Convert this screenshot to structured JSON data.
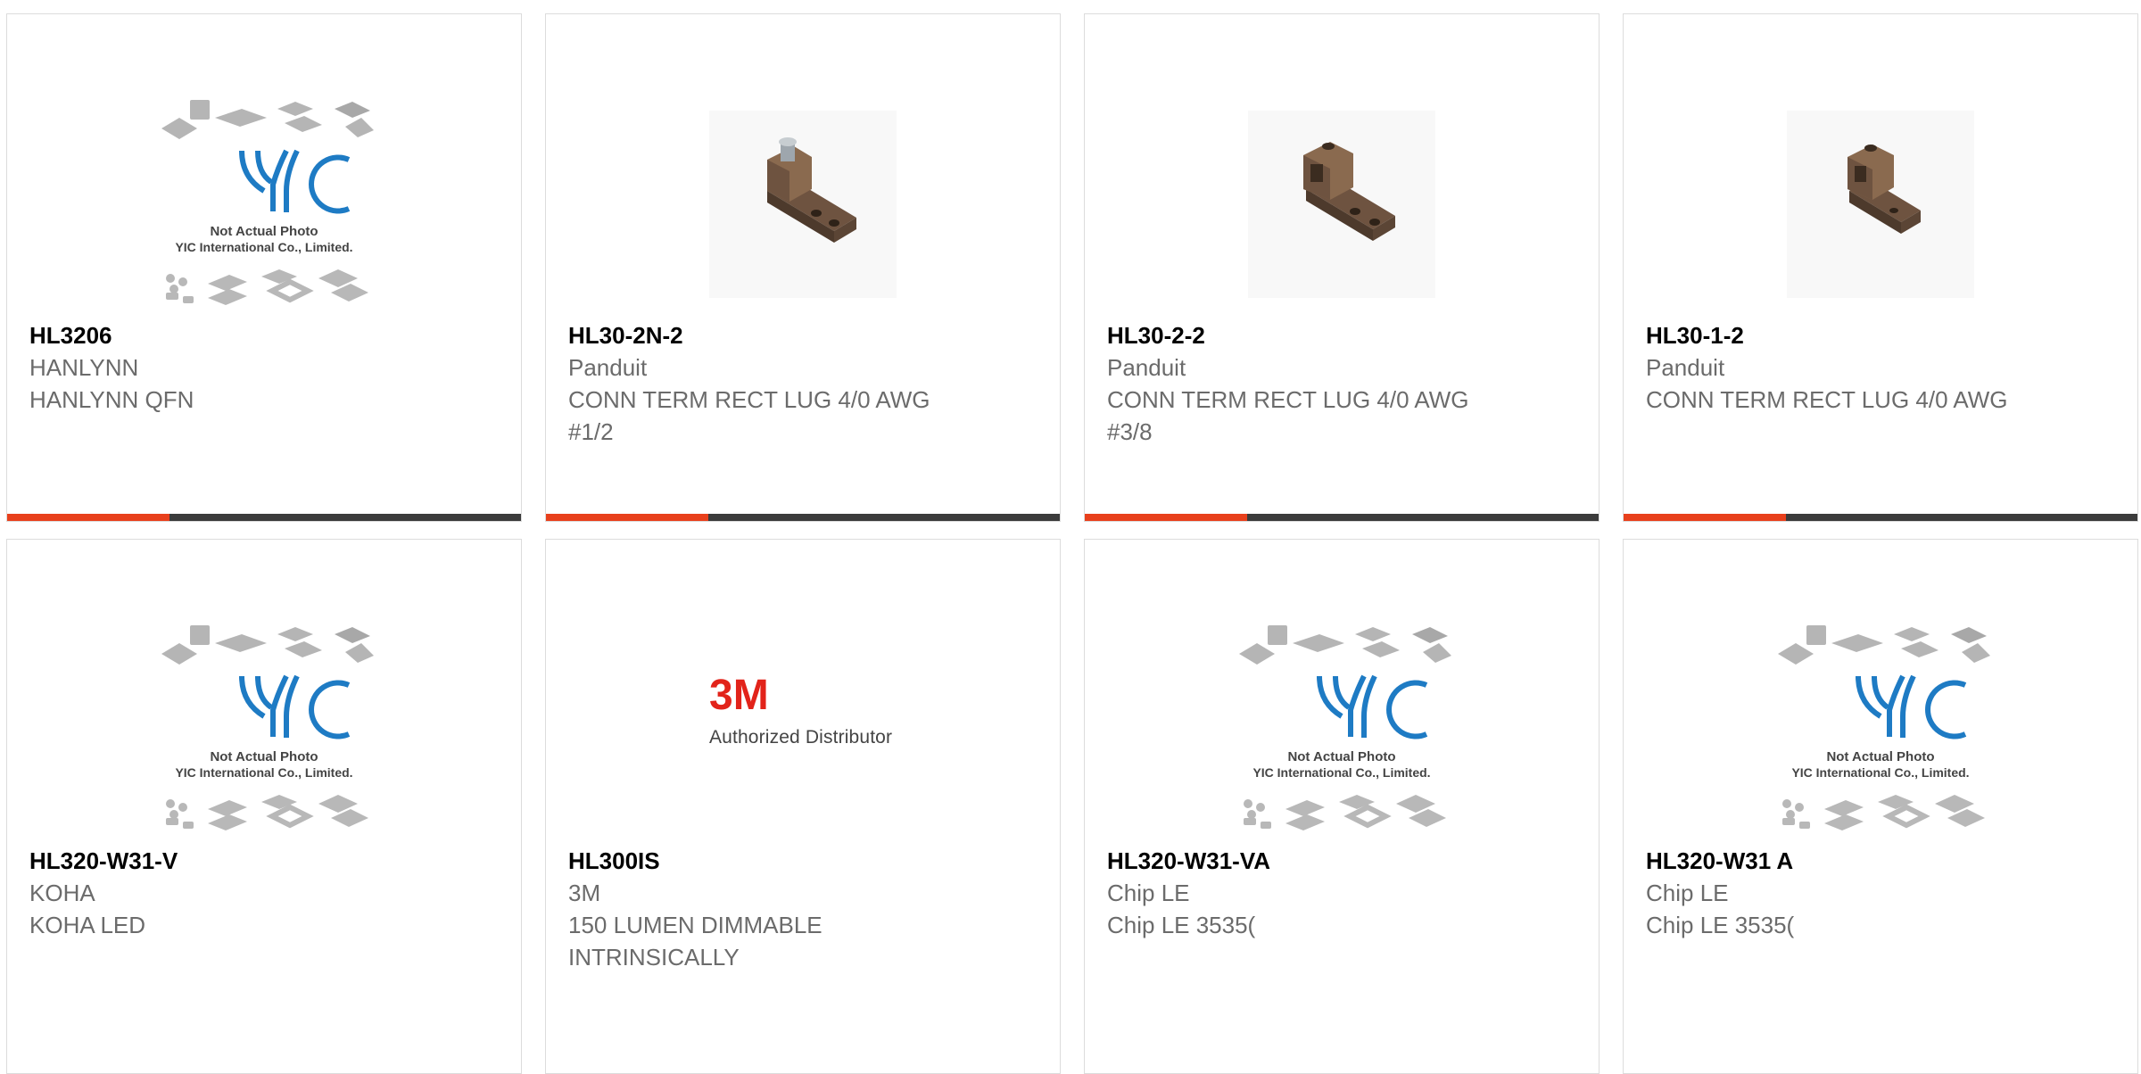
{
  "products": [
    {
      "part": "HL3206",
      "brand": "HANLYNN",
      "description": "HANLYNN QFN",
      "image": "placeholder",
      "placeholder_lines": [
        "Not Actual Photo",
        "YIC International Co., Limited."
      ],
      "placeholder_logo": "YIC"
    },
    {
      "part": "HL30-2N-2",
      "brand": "Panduit",
      "description": "CONN TERM RECT LUG 4/0 AWG #1/2",
      "image": "lug-photo"
    },
    {
      "part": "HL30-2-2",
      "brand": "Panduit",
      "description": "CONN TERM RECT LUG 4/0 AWG #3/8",
      "image": "lug-photo"
    },
    {
      "part": "HL30-1-2",
      "brand": "Panduit",
      "description": "CONN TERM RECT LUG 4/0 AWG",
      "image": "lug-photo"
    },
    {
      "part": "HL320-W31-V",
      "brand": "KOHA",
      "description": "KOHA LED",
      "image": "placeholder",
      "placeholder_lines": [
        "Not Actual Photo",
        "YIC International Co., Limited."
      ],
      "placeholder_logo": "YIC"
    },
    {
      "part": "HL300IS",
      "brand": "3M",
      "description": "150 LUMEN DIMMABLE INTRINSICALLY",
      "image": "brand-logo",
      "logo_text": "3M",
      "logo_caption": "Authorized Distributor"
    },
    {
      "part": "HL320-W31-VA",
      "brand": "Chip LE",
      "description": "Chip LE 3535(",
      "image": "placeholder",
      "placeholder_lines": [
        "Not Actual Photo",
        "YIC International Co., Limited."
      ],
      "placeholder_logo": "YIC"
    },
    {
      "part": "HL320-W31 A",
      "brand": "Chip LE",
      "description": "Chip LE 3535(",
      "image": "placeholder",
      "placeholder_lines": [
        "Not Actual Photo",
        "YIC International Co., Limited."
      ],
      "placeholder_logo": "YIC"
    }
  ],
  "colors": {
    "accent_orange": "#e8401c",
    "accent_dark": "#3b3b3b",
    "card_border": "#dcdcdc",
    "part_text": "#5a5a5a",
    "body_text": "#6b6b6b",
    "yic_blue": "#1e7bc4",
    "brand_3m_red": "#e2231a",
    "lug_bronze": "#8a6a4f"
  },
  "icons": {
    "placeholder": "chip-placeholder-icon",
    "lug-photo": "lug-connector-image",
    "brand-logo": "brand-3m-logo"
  }
}
